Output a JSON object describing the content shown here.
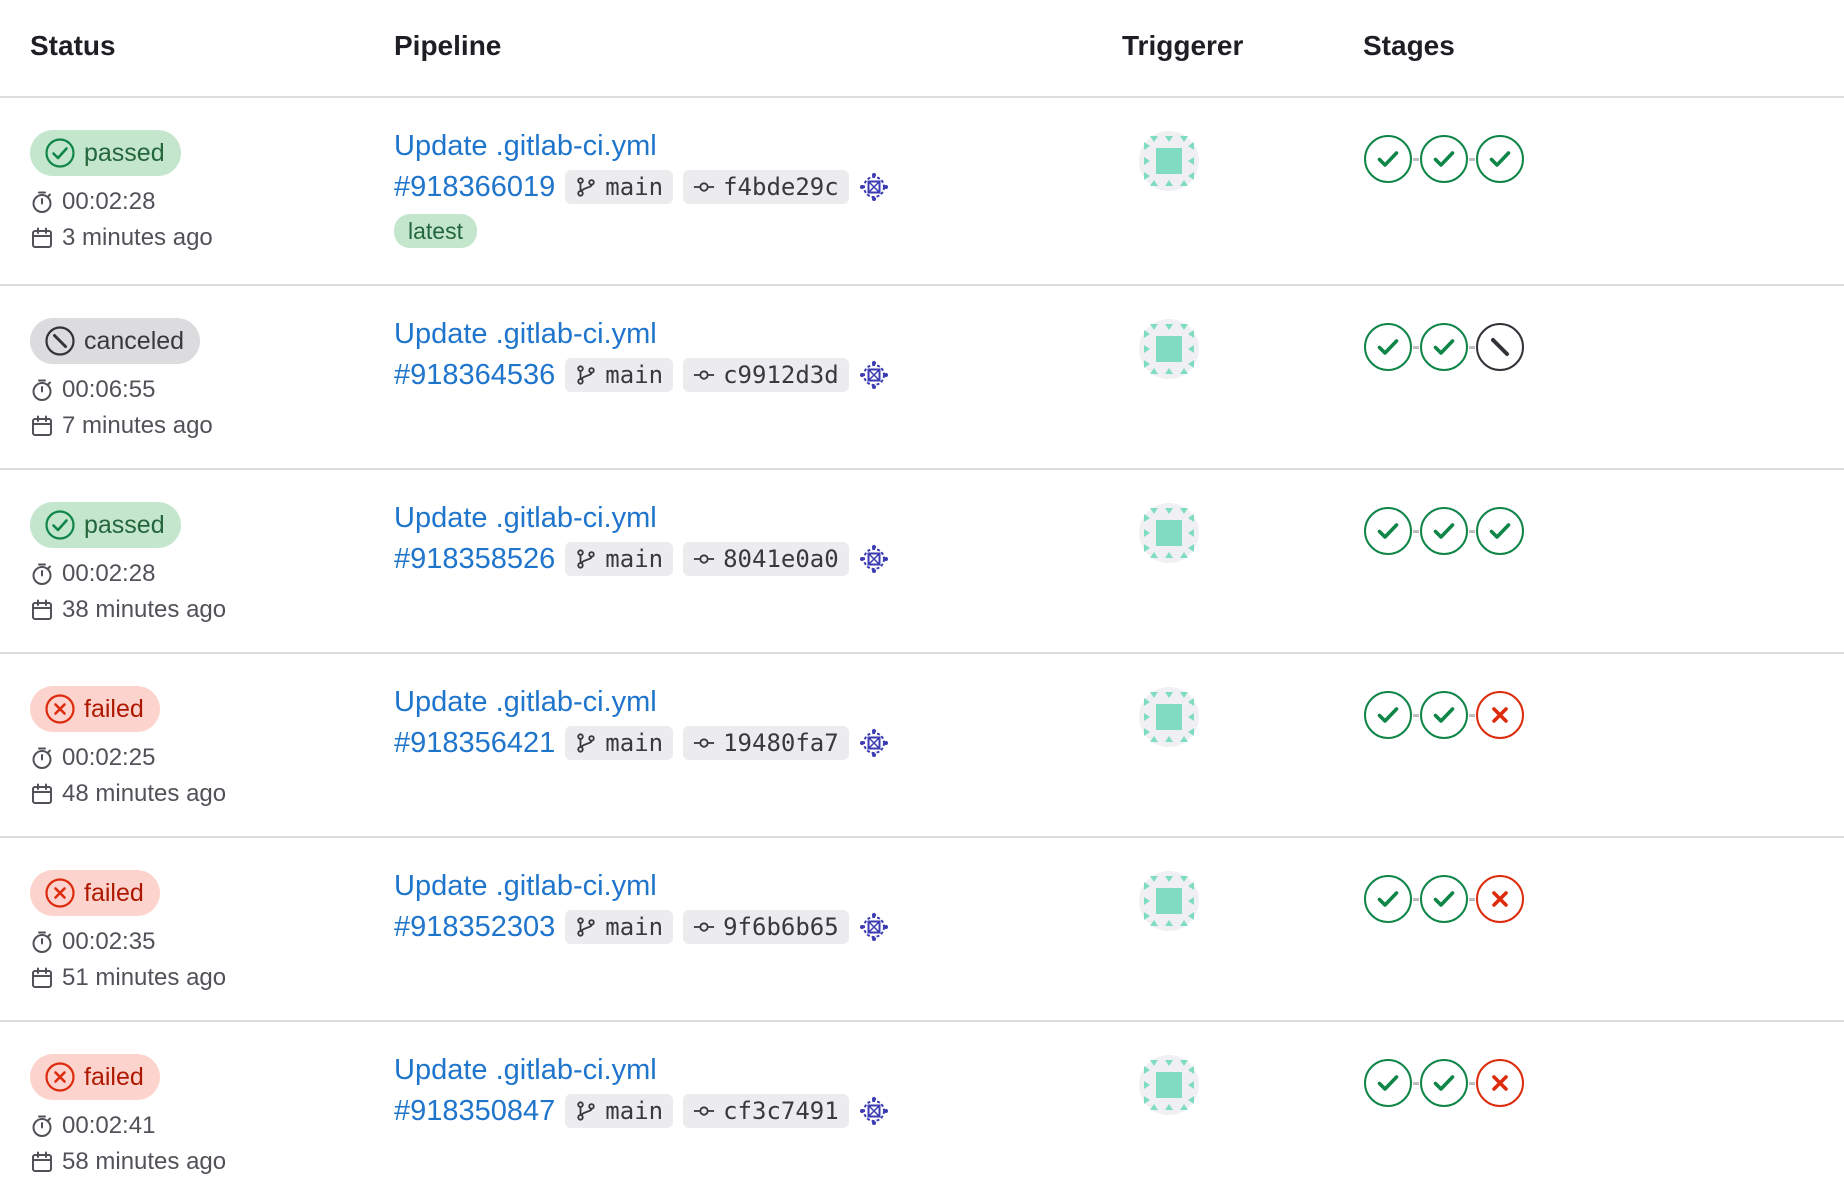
{
  "headers": {
    "status": "Status",
    "pipeline": "Pipeline",
    "triggerer": "Triggerer",
    "stages": "Stages"
  },
  "rows": [
    {
      "status": "passed",
      "status_kind": "success",
      "duration": "00:02:28",
      "time_ago": "3 minutes ago",
      "commit_title": "Update .gitlab-ci.yml",
      "pipeline_id": "#918366019",
      "branch": "main",
      "sha": "f4bde29c",
      "label": "latest",
      "stages": [
        "success",
        "success",
        "success"
      ]
    },
    {
      "status": "canceled",
      "status_kind": "canceled",
      "duration": "00:06:55",
      "time_ago": "7 minutes ago",
      "commit_title": "Update .gitlab-ci.yml",
      "pipeline_id": "#918364536",
      "branch": "main",
      "sha": "c9912d3d",
      "label": "",
      "stages": [
        "success",
        "success",
        "canceled"
      ]
    },
    {
      "status": "passed",
      "status_kind": "success",
      "duration": "00:02:28",
      "time_ago": "38 minutes ago",
      "commit_title": "Update .gitlab-ci.yml",
      "pipeline_id": "#918358526",
      "branch": "main",
      "sha": "8041e0a0",
      "label": "",
      "stages": [
        "success",
        "success",
        "success"
      ]
    },
    {
      "status": "failed",
      "status_kind": "failed",
      "duration": "00:02:25",
      "time_ago": "48 minutes ago",
      "commit_title": "Update .gitlab-ci.yml",
      "pipeline_id": "#918356421",
      "branch": "main",
      "sha": "19480fa7",
      "label": "",
      "stages": [
        "success",
        "success",
        "failed"
      ]
    },
    {
      "status": "failed",
      "status_kind": "failed",
      "duration": "00:02:35",
      "time_ago": "51 minutes ago",
      "commit_title": "Update .gitlab-ci.yml",
      "pipeline_id": "#918352303",
      "branch": "main",
      "sha": "9f6b6b65",
      "label": "",
      "stages": [
        "success",
        "success",
        "failed"
      ]
    },
    {
      "status": "failed",
      "status_kind": "failed",
      "duration": "00:02:41",
      "time_ago": "58 minutes ago",
      "commit_title": "Update .gitlab-ci.yml",
      "pipeline_id": "#918350847",
      "branch": "main",
      "sha": "cf3c7491",
      "label": "",
      "stages": [
        "success",
        "success",
        "failed"
      ]
    }
  ],
  "colors": {
    "success": "#108548",
    "failed": "#dd2b0e",
    "canceled": "#333238",
    "link": "#1f75cb",
    "avatar": "#7fdcc3",
    "gear": "#3b3bb3"
  }
}
